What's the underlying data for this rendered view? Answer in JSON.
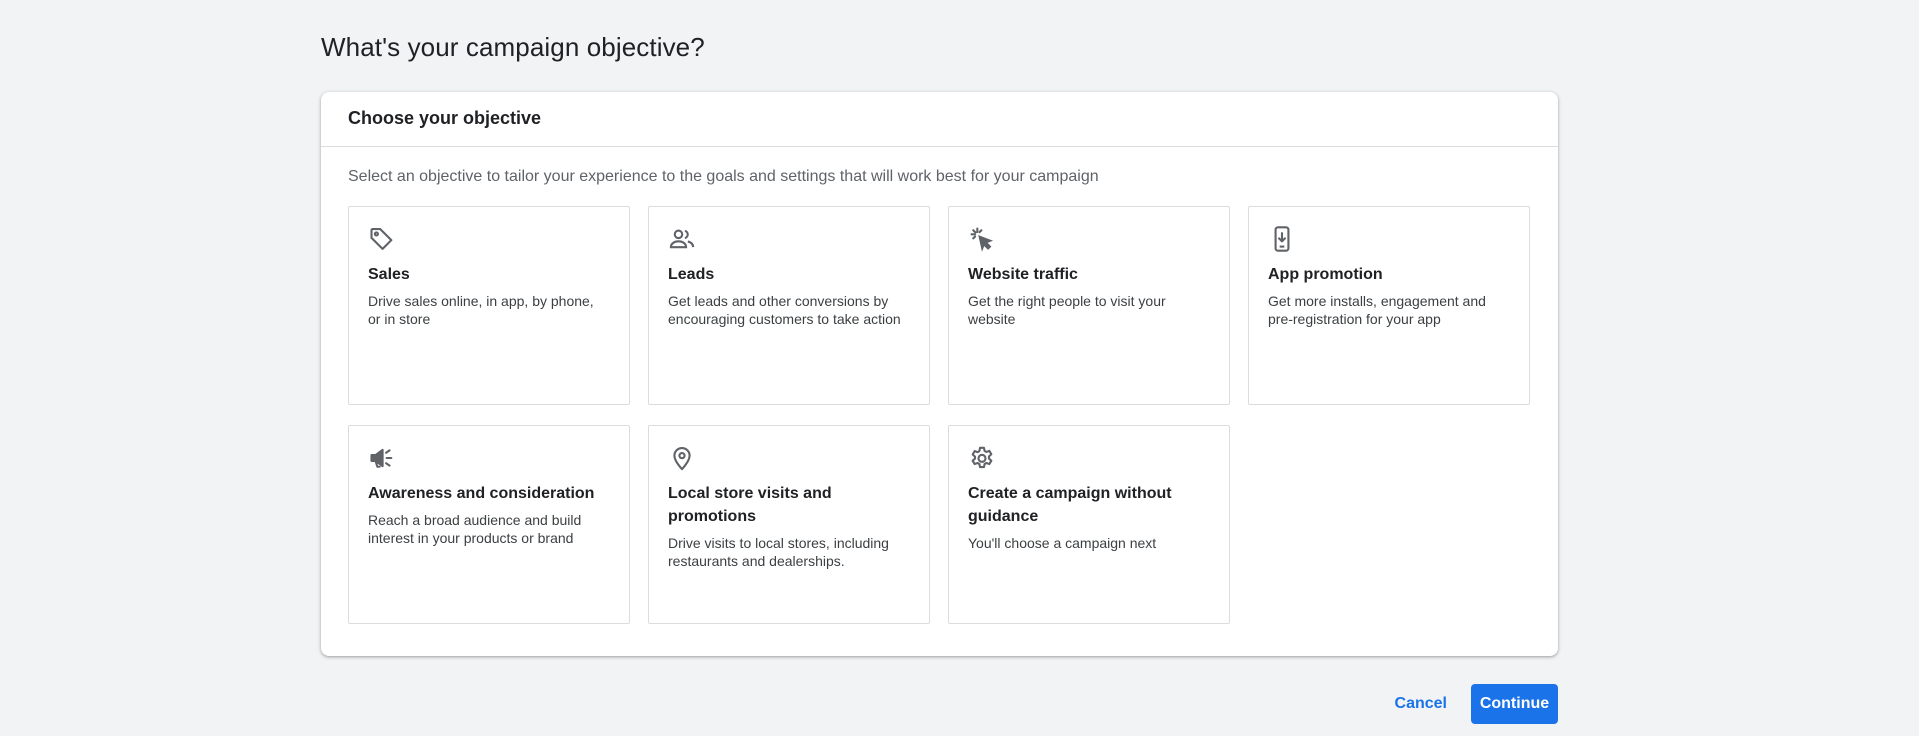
{
  "page": {
    "title": "What's your campaign objective?"
  },
  "card": {
    "header_title": "Choose your objective",
    "subtitle": "Select an objective to tailor your experience to the goals and settings that will work best for your campaign"
  },
  "objectives": [
    {
      "icon": "tag-icon",
      "title": "Sales",
      "description": "Drive sales online, in app, by phone, or in store"
    },
    {
      "icon": "people-icon",
      "title": "Leads",
      "description": "Get leads and other conversions by encouraging customers to take action"
    },
    {
      "icon": "cursor-click-icon",
      "title": "Website traffic",
      "description": "Get the right people to visit your website"
    },
    {
      "icon": "phone-download-icon",
      "title": "App promotion",
      "description": "Get more installs, engagement and pre-registration for your app"
    },
    {
      "icon": "megaphone-icon",
      "title": "Awareness and consideration",
      "description": "Reach a broad audience and build interest in your products or brand"
    },
    {
      "icon": "location-pin-icon",
      "title": "Local store visits and promotions",
      "description": "Drive visits to local stores, including restaurants and dealerships."
    },
    {
      "icon": "gear-icon",
      "title": "Create a campaign without guidance",
      "description": "You'll choose a campaign next"
    }
  ],
  "actions": {
    "cancel_label": "Cancel",
    "continue_label": "Continue"
  },
  "colors": {
    "accent": "#1a73e8",
    "background": "#f1f3f4",
    "icon": "#5f6368"
  }
}
